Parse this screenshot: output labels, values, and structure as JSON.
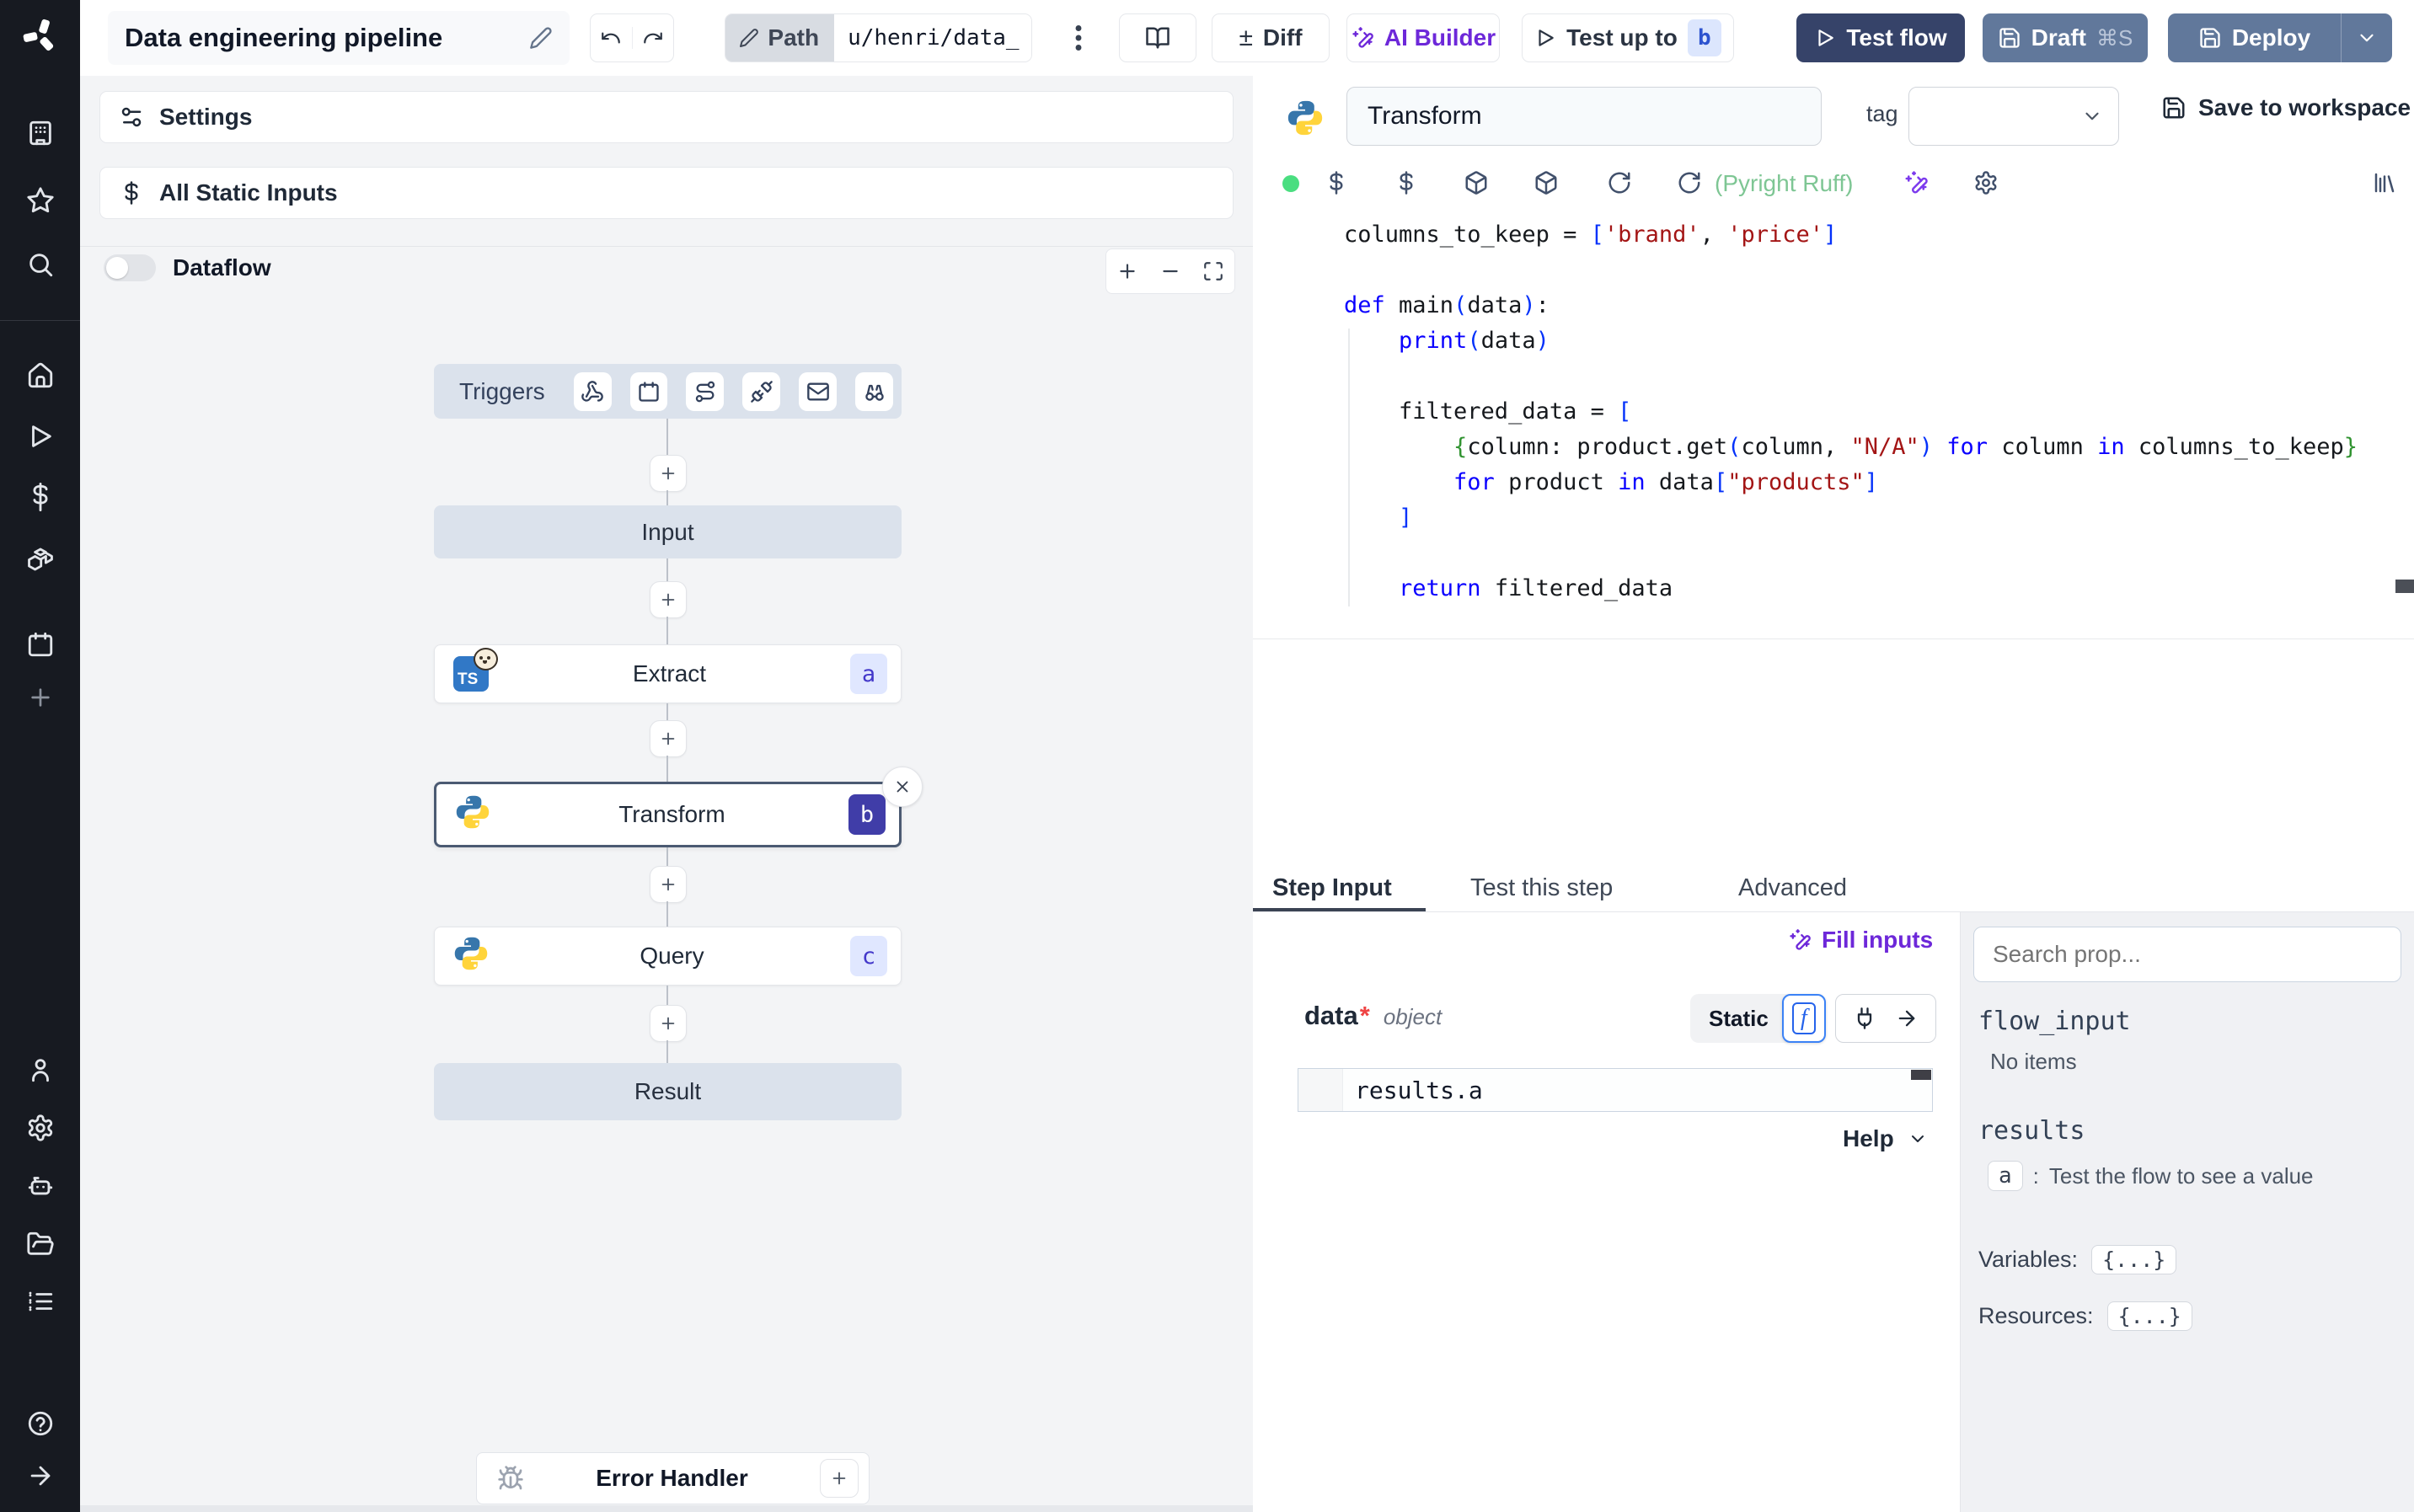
{
  "topbar": {
    "title": "Data engineering pipeline",
    "path_label": "Path",
    "path_value": "u/henri/data_",
    "diff_symbol": "±",
    "diff_label": "Diff",
    "ai_builder_label": "AI Builder",
    "test_up_to_label": "Test up to",
    "test_up_to_badge": "b",
    "test_flow_label": "Test flow",
    "draft_label": "Draft",
    "draft_shortcut": "⌘S",
    "deploy_label": "Deploy"
  },
  "sidebar": {
    "icons": [
      "workspace-icon",
      "star-icon",
      "search-icon",
      "home-icon",
      "runs-icon",
      "variables-icon",
      "resources-icon",
      "schedules-icon",
      "add-icon",
      "user-icon",
      "settings-icon",
      "workers-icon",
      "folders-icon",
      "audit-logs-icon",
      "help-icon",
      "expand-icon"
    ]
  },
  "flow": {
    "settings_label": "Settings",
    "static_inputs_label": "All Static Inputs",
    "dataflow_label": "Dataflow",
    "triggers_label": "Triggers",
    "trigger_icons": [
      "webhook-icon",
      "schedule-icon",
      "route-icon",
      "websocket-icon",
      "email-icon",
      "poll-icon"
    ],
    "input_label": "Input",
    "extract": {
      "label": "Extract",
      "badge": "a"
    },
    "transform": {
      "label": "Transform",
      "badge": "b"
    },
    "query": {
      "label": "Query",
      "badge": "c"
    },
    "result_label": "Result",
    "error_handler_label": "Error Handler"
  },
  "editor": {
    "step_name": "Transform",
    "tag_label": "tag",
    "save_label": "Save to workspace",
    "lint_status": "(Pyright Ruff)",
    "code_lines": [
      [
        [
          "p",
          "columns_to_keep = "
        ],
        [
          "b",
          "["
        ],
        [
          "s",
          "'brand'"
        ],
        [
          "p",
          ", "
        ],
        [
          "s",
          "'price'"
        ],
        [
          "b",
          "]"
        ]
      ],
      [],
      [
        [
          "k",
          "def "
        ],
        [
          "p",
          "main"
        ],
        [
          "b",
          "("
        ],
        [
          "p",
          "data"
        ],
        [
          "b",
          ")"
        ],
        [
          "p",
          ":"
        ]
      ],
      [
        [
          "p",
          "    "
        ],
        [
          "k",
          "print"
        ],
        [
          "b",
          "("
        ],
        [
          "p",
          "data"
        ],
        [
          "b",
          ")"
        ]
      ],
      [],
      [
        [
          "p",
          "    filtered_data = "
        ],
        [
          "b",
          "["
        ]
      ],
      [
        [
          "p",
          "        "
        ],
        [
          "g",
          "{"
        ],
        [
          "p",
          "column: product.get"
        ],
        [
          "b",
          "("
        ],
        [
          "p",
          "column, "
        ],
        [
          "s",
          "\"N/A\""
        ],
        [
          "b",
          ")"
        ],
        [
          "p",
          " "
        ],
        [
          "k",
          "for"
        ],
        [
          "p",
          " column "
        ],
        [
          "k",
          "in"
        ],
        [
          "p",
          " columns_to_keep"
        ],
        [
          "g",
          "}"
        ]
      ],
      [
        [
          "p",
          "        "
        ],
        [
          "k",
          "for"
        ],
        [
          "p",
          " product "
        ],
        [
          "k",
          "in"
        ],
        [
          "p",
          " data"
        ],
        [
          "b",
          "["
        ],
        [
          "s",
          "\"products\""
        ],
        [
          "b",
          "]"
        ]
      ],
      [
        [
          "p",
          "    "
        ],
        [
          "b",
          "]"
        ]
      ],
      [],
      [
        [
          "p",
          "    "
        ],
        [
          "k",
          "return"
        ],
        [
          "p",
          " filtered_data"
        ]
      ]
    ]
  },
  "step_panel": {
    "tabs": [
      {
        "label": "Step Input"
      },
      {
        "label": "Test this step"
      },
      {
        "label": "Advanced"
      }
    ],
    "fill_inputs_label": "Fill inputs",
    "field_name": "data",
    "field_required_mark": "*",
    "field_type": "object",
    "static_label": "Static",
    "fn_symbol": "f",
    "expression": "results.a",
    "help_label": "Help"
  },
  "props_panel": {
    "search_placeholder": "Search prop...",
    "flow_input_label": "flow_input",
    "flow_input_empty": "No items",
    "results_label": "results",
    "result_key": "a",
    "result_sep": ":",
    "result_hint": "Test the flow to see a value",
    "variables_label": "Variables:",
    "variables_value": "{...}",
    "resources_label": "Resources:",
    "resources_value": "{...}"
  },
  "colors": {
    "accent_purple": "#6d28d9",
    "brand_dark": "#364369",
    "brand_slate": "#61789b",
    "badge_bg": "#e0e7ff",
    "badge_text": "#4338ca",
    "selected_badge_bg": "#403da8",
    "lint_green": "#7ec694",
    "node_bg": "#dbe2ec",
    "status_ok": "#4ade80"
  }
}
